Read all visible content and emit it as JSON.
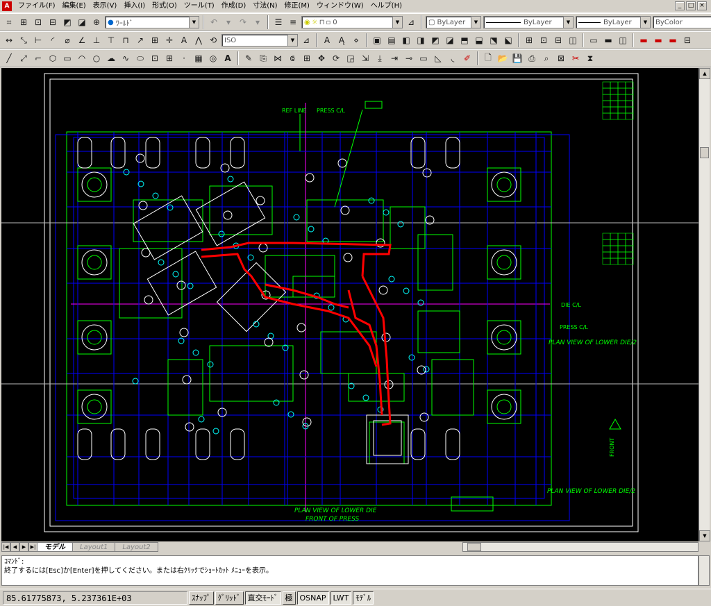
{
  "app": {
    "icon": "autocad-icon",
    "icon_glyph": "A"
  },
  "menu": [
    "ファイル(F)",
    "編集(E)",
    "表示(V)",
    "挿入(I)",
    "形式(O)",
    "ツール(T)",
    "作成(D)",
    "寸法(N)",
    "修正(M)",
    "ウィンドウ(W)",
    "ヘルプ(H)"
  ],
  "window_controls": [
    "_",
    "□",
    "×"
  ],
  "toolbar1": {
    "view_combo": "ﾜｰﾙﾄﾞ",
    "layer_combo": "0",
    "color_combo": "ByLayer",
    "linetype_combo": "ByLayer",
    "lineweight_combo": "ByLayer",
    "plotstyle_combo": "ByColor"
  },
  "toolbar2": {
    "dimstyle_combo": "ISO"
  },
  "drawing": {
    "labels": {
      "ref_line": "REF LINE",
      "press_cl_top": "PRESS C/L",
      "press_cl_right": "PRESS C/L",
      "die_cl": "DIE C/L",
      "plan_view_right": "PLAN VIEW OF LOWER DIE/2",
      "plan_view_bottom_right": "PLAN VIEW OF LOWER DIE/2",
      "plan_view_center": "PLAN VIEW OF LOWER DIE",
      "front_of_press": "FRONT OF PRESS",
      "front_arrow": "FRONT"
    }
  },
  "tabs": [
    "モデル",
    "Layout1",
    "Layout2"
  ],
  "tab_nav": [
    "|◀",
    "◀",
    "▶",
    "▶|"
  ],
  "command": {
    "line1": "ｺﾏﾝﾄﾞ:",
    "line2": "終了するには[Esc]か[Enter]を押してください。または右ｸﾘｯｸでｼｮｰﾄｶｯﾄ ﾒﾆｭｰを表示。"
  },
  "status": {
    "coords": "85.61775873, 5.237361E+03",
    "buttons": [
      "ｽﾅｯﾌﾟ",
      "ｸﾞﾘｯﾄﾞ",
      "直交ﾓｰﾄﾞ",
      "極",
      "OSNAP",
      "LWT",
      "ﾓﾃﾞﾙ"
    ],
    "on_states": [
      false,
      false,
      true,
      false,
      true,
      true,
      true
    ]
  },
  "colors": {
    "canvas": "#000000",
    "lines_green": "#00ff00",
    "lines_blue": "#0000ff",
    "lines_red": "#ff0000",
    "lines_cyan": "#00ffff",
    "lines_white": "#ffffff",
    "lines_magenta": "#ff00ff"
  }
}
